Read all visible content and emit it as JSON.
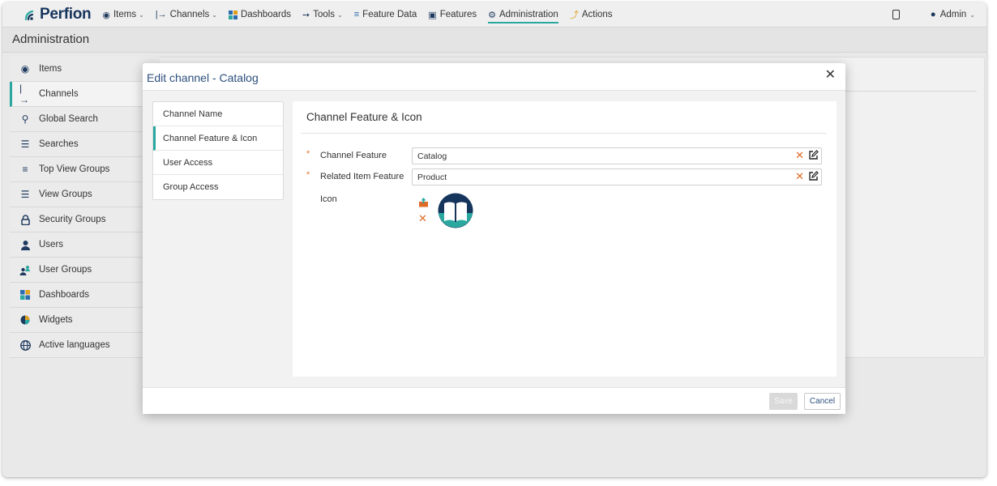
{
  "app": {
    "logo_text": "Perfion",
    "brand_color": "#16355c",
    "accent_color": "#2aa8a0",
    "warning_color": "#e06a25"
  },
  "nav": {
    "items": [
      {
        "label": "Items",
        "icon": "cube-icon",
        "has_menu": true
      },
      {
        "label": "Channels",
        "icon": "channel-arrow-icon",
        "has_menu": true
      },
      {
        "label": "Dashboards",
        "icon": "dashboard-tiles-icon",
        "has_menu": false
      },
      {
        "label": "Tools",
        "icon": "wrench-icon",
        "has_menu": true
      },
      {
        "label": "Feature Data",
        "icon": "feature-list-icon",
        "has_menu": false
      },
      {
        "label": "Features",
        "icon": "database-icon",
        "has_menu": false
      },
      {
        "label": "Administration",
        "icon": "gear-icon",
        "has_menu": false,
        "active": true
      },
      {
        "label": "Actions",
        "icon": "actions-icon",
        "has_menu": false
      }
    ],
    "user_label": "Admin"
  },
  "page": {
    "title": "Administration"
  },
  "sidebar": {
    "items": [
      {
        "label": "Items",
        "icon": "cube-icon"
      },
      {
        "label": "Channels",
        "icon": "channel-arrow-icon",
        "active": true
      },
      {
        "label": "Global Search",
        "icon": "search-icon"
      },
      {
        "label": "Searches",
        "icon": "searches-list-icon"
      },
      {
        "label": "Top View Groups",
        "icon": "top-view-groups-icon"
      },
      {
        "label": "View Groups",
        "icon": "view-groups-icon"
      },
      {
        "label": "Security Groups",
        "icon": "lock-icon"
      },
      {
        "label": "Users",
        "icon": "user-icon"
      },
      {
        "label": "User Groups",
        "icon": "user-group-icon"
      },
      {
        "label": "Dashboards",
        "icon": "dashboard-tiles-icon"
      },
      {
        "label": "Widgets",
        "icon": "pie-chart-icon"
      },
      {
        "label": "Active languages",
        "icon": "globe-icon"
      }
    ]
  },
  "modal": {
    "title": "Edit channel - Catalog",
    "tabs": [
      {
        "label": "Channel Name"
      },
      {
        "label": "Channel Feature & Icon",
        "active": true
      },
      {
        "label": "User Access"
      },
      {
        "label": "Group Access"
      }
    ],
    "section_title": "Channel Feature & Icon",
    "fields": {
      "channel_feature": {
        "label": "Channel Feature",
        "value": "Catalog",
        "required": "*"
      },
      "related_item_feature": {
        "label": "Related Item Feature",
        "value": "Product",
        "required": "*"
      }
    },
    "icon_label": "Icon",
    "icon_name": "open-book-icon",
    "save_label": "Save",
    "cancel_label": "Cancel"
  }
}
